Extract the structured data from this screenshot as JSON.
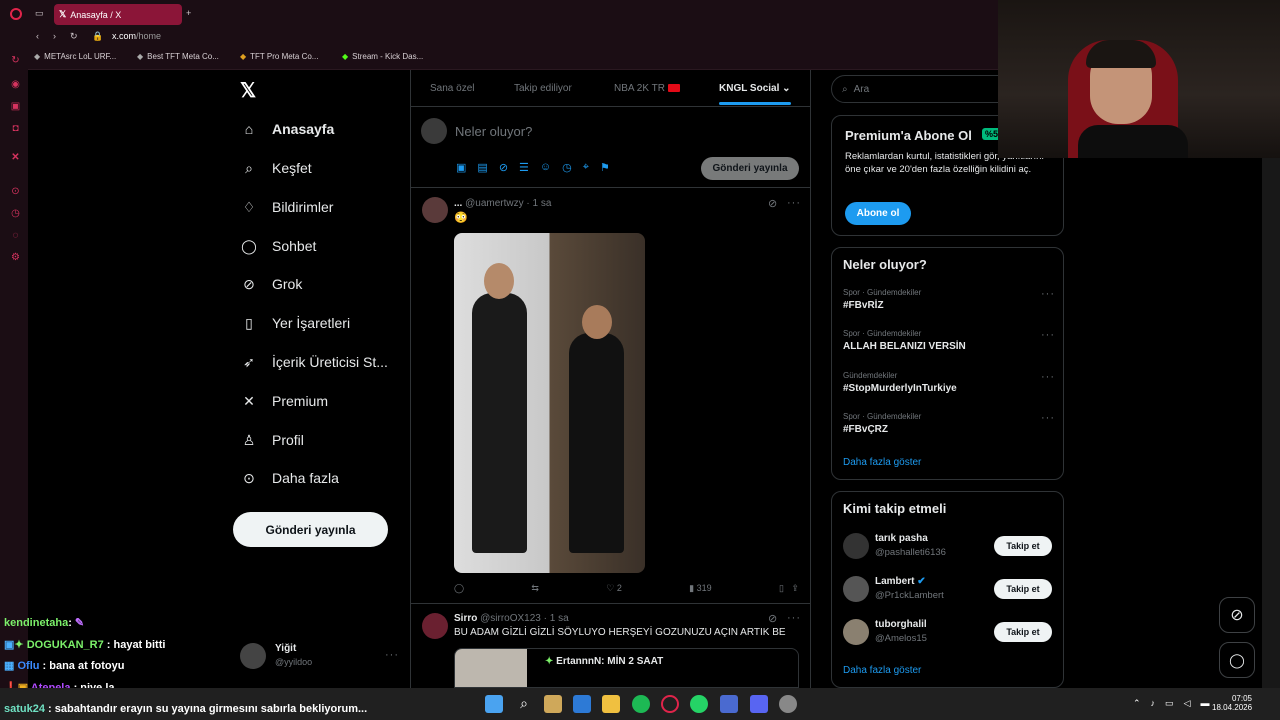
{
  "browser": {
    "tab_title": "Anasayfa / X",
    "url_host": "x.com",
    "url_path": "/home",
    "bookmarks": [
      "METAsrc LoL URF...",
      "Best TFT Meta Co...",
      "TFT Pro Meta Co...",
      "Stream - Kick Das..."
    ]
  },
  "nav": {
    "items": [
      "Anasayfa",
      "Keşfet",
      "Bildirimler",
      "Sohbet",
      "Grok",
      "Yer İşaretleri",
      "İçerik Üreticisi St...",
      "Premium",
      "Profil",
      "Daha fazla"
    ],
    "post_label": "Gönderi yayınla",
    "user_name": "Yiğit",
    "user_handle": "@yyildoo"
  },
  "feed": {
    "tabs": [
      "Sana özel",
      "Takip ediliyor",
      "NBA 2K TR",
      "KNGL Social"
    ],
    "compose_placeholder": "Neler oluyor?",
    "compose_button": "Gönderi yayınla",
    "post1": {
      "name": "...",
      "handle": "@uamertwzy",
      "time": "· 1 sa",
      "text": "😳",
      "likes": "2",
      "views": "319"
    },
    "post2": {
      "name": "Sirro",
      "handle": "@sirroOX123",
      "time": "· 1 sa",
      "text": "BU ADAM GİZLİ GİZLİ SÖYLUYO HERŞEYİ GOZUNUZU AÇIN ARTIK BE",
      "quote_name": "ErtannnN: MİN 2 SAAT"
    }
  },
  "search": {
    "placeholder": "Ara"
  },
  "premium": {
    "title": "Premium'a Abone Ol",
    "badge": "%5",
    "body": "Reklamlardan kurtul, istatistikleri gör, yanıtlarını öne çıkar ve 20'den fazla özelliğin kilidini aç.",
    "button": "Abone ol"
  },
  "trends": {
    "title": "Neler oluyor?",
    "items": [
      {
        "cat": "Spor · Gündemdekiler",
        "name": "#FBvRİZ"
      },
      {
        "cat": "Spor · Gündemdekiler",
        "name": "ALLAH BELANIZI VERSİN"
      },
      {
        "cat": "Gündemdekiler",
        "name": "#StopMurderlyInTurkiye"
      },
      {
        "cat": "Spor · Gündemdekiler",
        "name": "#FBvÇRZ"
      }
    ],
    "more": "Daha fazla göster"
  },
  "who_to_follow": {
    "title": "Kimi takip etmeli",
    "users": [
      {
        "name": "tarık pasha",
        "handle": "@pashalleti6136",
        "button": "Takip et"
      },
      {
        "name": "Lambert",
        "handle": "@Pr1ckLambert",
        "button": "Takip et"
      },
      {
        "name": "tuborghalil",
        "handle": "@Amelos15",
        "button": "Takip et"
      }
    ],
    "more": "Daha fazla göster"
  },
  "chat": [
    {
      "user": "kendinetaha",
      "msg": ":",
      "color": "#7cf06a"
    },
    {
      "user": "DOGUKAN_R7",
      "msg": ": hayat bitti",
      "color": "#7cf06a"
    },
    {
      "user": "Oflu",
      "msg": ": bana at fotoyu",
      "color": "#3b8bff"
    },
    {
      "user": "Atepela",
      "msg": ": niye la",
      "color": "#b14bff"
    },
    {
      "user": "satuk24",
      "msg": ": sabahtandır erayın su yayına girmesını sabırla bekliyorum...",
      "color": "#6fe0c2"
    }
  ],
  "system": {
    "time": "07:05",
    "date": "18.04.2026"
  }
}
